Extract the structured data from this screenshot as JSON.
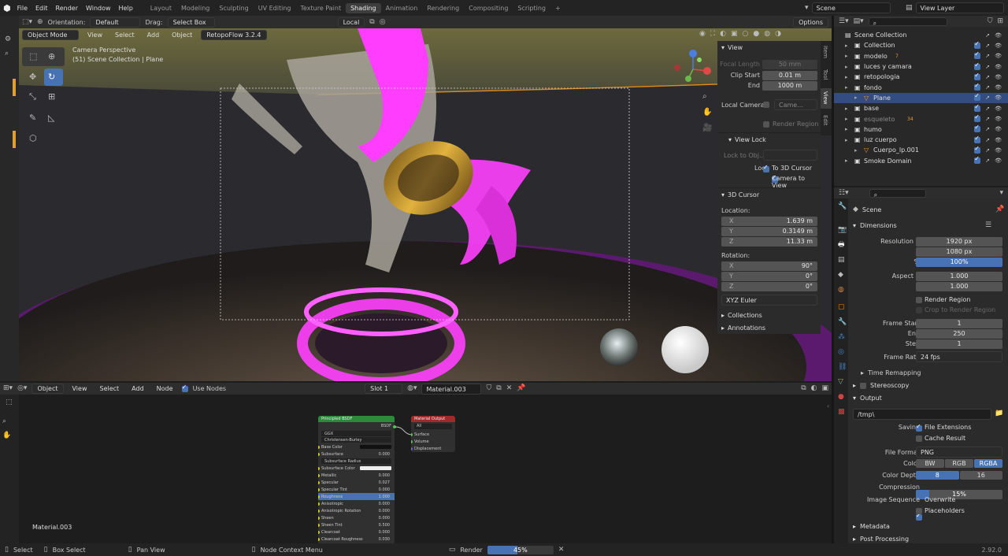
{
  "menu": [
    "File",
    "Edit",
    "Render",
    "Window",
    "Help"
  ],
  "workspaces": [
    "Layout",
    "Modeling",
    "Sculpting",
    "UV Editing",
    "Texture Paint",
    "Shading",
    "Animation",
    "Rendering",
    "Compositing",
    "Scripting"
  ],
  "active_workspace": "Shading",
  "scene_name": "Scene",
  "view_layer": "View Layer",
  "viewport_toolbar": {
    "orientation_label": "Orientation:",
    "orientation_value": "Default",
    "drag_label": "Drag:",
    "drag_value": "Select Box",
    "transform": "Local",
    "options": "Options"
  },
  "viewport_header": {
    "mode": "Object Mode",
    "view": "View",
    "select": "Select",
    "add": "Add",
    "object": "Object",
    "addon": "RetopoFlow 3.2.4"
  },
  "viewport_overlay": {
    "line1": "Camera Perspective",
    "line2": "(51) Scene Collection | Plane"
  },
  "npanel": {
    "tabs": [
      "Item",
      "Tool",
      "View",
      "Edit"
    ],
    "view_title": "View",
    "focal_label": "Focal Length",
    "focal_value": "50 mm",
    "clip_start_label": "Clip Start",
    "clip_start_value": "0.01 m",
    "end_label": "End",
    "end_value": "1000 m",
    "local_camera_label": "Local Camera",
    "local_camera_value": "Came...",
    "render_region": "Render Region",
    "view_lock_title": "View Lock",
    "lock_obj_label": "Lock to Obj...",
    "lock_label": "Lock",
    "to_3d_cursor": "To 3D Cursor",
    "camera_to_view": "Camera to View",
    "cursor_title": "3D Cursor",
    "location_label": "Location:",
    "loc_x": "1.639 m",
    "loc_y": "0.3149 m",
    "loc_z": "11.33 m",
    "rotation_label": "Rotation:",
    "rot_x": "90°",
    "rot_y": "0°",
    "rot_z": "0°",
    "rot_mode": "XYZ Euler",
    "collections": "Collections",
    "annotations": "Annotations",
    "axis_x": "X",
    "axis_y": "Y",
    "axis_z": "Z"
  },
  "outliner": {
    "search_placeholder": "",
    "items": [
      {
        "label": "Scene Collection",
        "indent": 0
      },
      {
        "label": "Collection",
        "indent": 1
      },
      {
        "label": "modelo",
        "indent": 1,
        "badge": "7"
      },
      {
        "label": "luces y camara",
        "indent": 1
      },
      {
        "label": "retopologia",
        "indent": 1
      },
      {
        "label": "fondo",
        "indent": 1
      },
      {
        "label": "Plane",
        "indent": 2,
        "selected": true
      },
      {
        "label": "base",
        "indent": 1
      },
      {
        "label": "esqueleto",
        "indent": 1,
        "badge": "34"
      },
      {
        "label": "humo",
        "indent": 1
      },
      {
        "label": "luz cuerpo",
        "indent": 1
      },
      {
        "label": "Cuerpo_lp.001",
        "indent": 2
      },
      {
        "label": "Smoke Domain",
        "indent": 1
      }
    ]
  },
  "properties": {
    "scene_label": "Scene",
    "dimensions_title": "Dimensions",
    "res_x_label": "Resolution X",
    "res_x": "1920 px",
    "res_y_label": "Y",
    "res_y": "1080 px",
    "res_pct_label": "%",
    "res_pct": "100%",
    "aspect_x_label": "Aspect X",
    "aspect_x": "1.000",
    "aspect_y_label": "Y",
    "aspect_y": "1.000",
    "render_region": "Render Region",
    "crop": "Crop to Render Region",
    "frame_start_label": "Frame Start",
    "frame_start": "1",
    "frame_end_label": "End",
    "frame_end": "250",
    "step_label": "Step",
    "step": "1",
    "frame_rate_label": "Frame Rate",
    "frame_rate": "24 fps",
    "time_remapping": "Time Remapping",
    "stereoscopy": "Stereoscopy",
    "output_title": "Output",
    "output_path": "/tmp\\",
    "saving_label": "Saving",
    "file_extensions": "File Extensions",
    "cache_result": "Cache Result",
    "file_format_label": "File Format",
    "file_format": "PNG",
    "color_label": "Color",
    "color_opts": [
      "BW",
      "RGB",
      "RGBA"
    ],
    "color_depth_label": "Color Depth",
    "color_depth_opts": [
      "8",
      "16"
    ],
    "compression_label": "Compression",
    "compression": "15%",
    "compression_fraction": 0.15,
    "image_sequence_label": "Image Sequence",
    "overwrite": "Overwrite",
    "placeholders": "Placeholders",
    "metadata": "Metadata",
    "post_processing": "Post Processing"
  },
  "node_editor": {
    "type": "Object",
    "view": "View",
    "select": "Select",
    "add": "Add",
    "node": "Node",
    "use_nodes": "Use Nodes",
    "slot": "Slot 1",
    "material": "Material.003",
    "material_label": "Material.003",
    "bsdf_title": "Principled BSDF",
    "bsdf_out": "BSDF",
    "bsdf_rows": [
      {
        "l": "GGX",
        "v": ""
      },
      {
        "l": "Christensen-Burley",
        "v": ""
      },
      {
        "l": "Base Color",
        "v": ""
      },
      {
        "l": "Subsurface",
        "v": "0.000"
      },
      {
        "l": "Subsurface Radius",
        "v": ""
      },
      {
        "l": "Subsurface Color",
        "v": ""
      },
      {
        "l": "Metallic",
        "v": "0.000"
      },
      {
        "l": "Specular",
        "v": "0.027"
      },
      {
        "l": "Specular Tint",
        "v": "0.000"
      },
      {
        "l": "Roughness",
        "v": "1.000"
      },
      {
        "l": "Anisotropic",
        "v": "0.000"
      },
      {
        "l": "Anisotropic Rotation",
        "v": "0.000"
      },
      {
        "l": "Sheen",
        "v": "0.000"
      },
      {
        "l": "Sheen Tint",
        "v": "0.500"
      },
      {
        "l": "Clearcoat",
        "v": "0.000"
      },
      {
        "l": "Clearcoat Roughness",
        "v": "0.030"
      }
    ],
    "out_title": "Material Output",
    "out_target": "All",
    "out_rows": [
      "Surface",
      "Volume",
      "Displacement"
    ]
  },
  "statusbar": {
    "select": "Select",
    "box_select": "Box Select",
    "pan_view": "Pan View",
    "context": "Node Context Menu",
    "render_label": "Render",
    "render_progress": "45%",
    "render_fraction": 0.45,
    "version": "2.92.0"
  },
  "colors": {
    "accent": "#4772b3",
    "selected_row": "#334d80",
    "emission_pink": "#ff40ff",
    "header_bg": "#2d2d2d"
  }
}
